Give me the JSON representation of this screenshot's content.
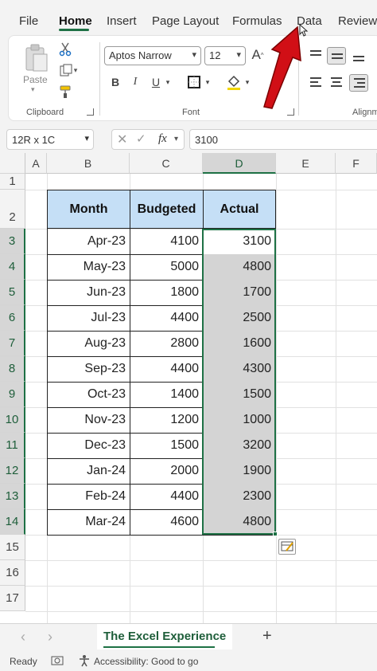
{
  "menu": {
    "tabs": [
      "File",
      "Home",
      "Insert",
      "Page Layout",
      "Formulas",
      "Data",
      "Review"
    ],
    "active_tab": "Home"
  },
  "ribbon": {
    "clipboard": {
      "paste_label": "Paste",
      "group_label": "Clipboard"
    },
    "font": {
      "font_name": "Aptos Narrow",
      "font_size": "12",
      "bold": "B",
      "italic": "I",
      "underline": "U",
      "group_label": "Font"
    },
    "alignment": {
      "group_label": "Alignm"
    }
  },
  "formula_bar": {
    "name_box": "12R x 1C",
    "fx_label": "fx",
    "formula": "3100"
  },
  "grid": {
    "columns": [
      "A",
      "B",
      "C",
      "D",
      "E",
      "F"
    ],
    "rows": [
      "1",
      "2",
      "3",
      "4",
      "5",
      "6",
      "7",
      "8",
      "9",
      "10",
      "11",
      "12",
      "13",
      "14",
      "15",
      "16",
      "17"
    ],
    "selected_column": "D",
    "table_headers": [
      "Month",
      "Budgeted",
      "Actual"
    ],
    "table_rows": [
      [
        "Apr-23",
        "4100",
        "3100"
      ],
      [
        "May-23",
        "5000",
        "4800"
      ],
      [
        "Jun-23",
        "1800",
        "1700"
      ],
      [
        "Jul-23",
        "4400",
        "2500"
      ],
      [
        "Aug-23",
        "2800",
        "1600"
      ],
      [
        "Sep-23",
        "4400",
        "4300"
      ],
      [
        "Oct-23",
        "1400",
        "1500"
      ],
      [
        "Nov-23",
        "1200",
        "1000"
      ],
      [
        "Dec-23",
        "1500",
        "3200"
      ],
      [
        "Jan-24",
        "2000",
        "1900"
      ],
      [
        "Feb-24",
        "4400",
        "2300"
      ],
      [
        "Mar-24",
        "4600",
        "4800"
      ]
    ]
  },
  "sheets": {
    "active": "The Excel Experience",
    "add_label": "+",
    "prev": "‹",
    "next": "›"
  },
  "status": {
    "ready": "Ready",
    "accessibility": "Accessibility: Good to go"
  },
  "colors": {
    "accent": "#1e7145",
    "header_fill": "#c5dff6",
    "selection_fill": "#d4d4d4",
    "arrow": "#d10f16"
  }
}
